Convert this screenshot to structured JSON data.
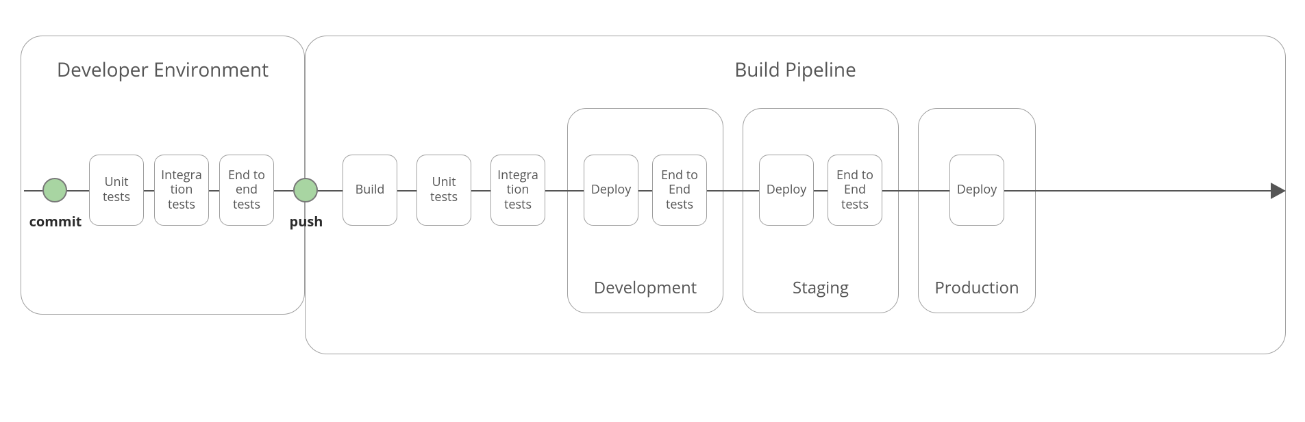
{
  "colors": {
    "border": "#9e9e9e",
    "text": "#555555",
    "dot_fill": "#a8d5a2",
    "dot_border": "#777777",
    "line": "#555555"
  },
  "panels": {
    "developer": {
      "title": "Developer Environment"
    },
    "pipeline": {
      "title": "Build Pipeline"
    }
  },
  "events": {
    "commit": "commit",
    "push": "push"
  },
  "developer_steps": [
    {
      "id": "dev-unit",
      "label": "Unit tests"
    },
    {
      "id": "dev-integration",
      "label": "Integra tion tests"
    },
    {
      "id": "dev-e2e",
      "label": "End to end tests"
    }
  ],
  "pipeline_steps": [
    {
      "id": "build",
      "label": "Build"
    },
    {
      "id": "pipe-unit",
      "label": "Unit tests"
    },
    {
      "id": "pipe-integration",
      "label": "Integra tion tests"
    }
  ],
  "environments": [
    {
      "id": "development",
      "title": "Development",
      "steps": [
        {
          "id": "dev-deploy",
          "label": "Deploy"
        },
        {
          "id": "dev-e2e2",
          "label": "End to End tests"
        }
      ]
    },
    {
      "id": "staging",
      "title": "Staging",
      "steps": [
        {
          "id": "stg-deploy",
          "label": "Deploy"
        },
        {
          "id": "stg-e2e",
          "label": "End to End tests"
        }
      ]
    },
    {
      "id": "production",
      "title": "Production",
      "steps": [
        {
          "id": "prod-deploy",
          "label": "Deploy"
        }
      ]
    }
  ]
}
